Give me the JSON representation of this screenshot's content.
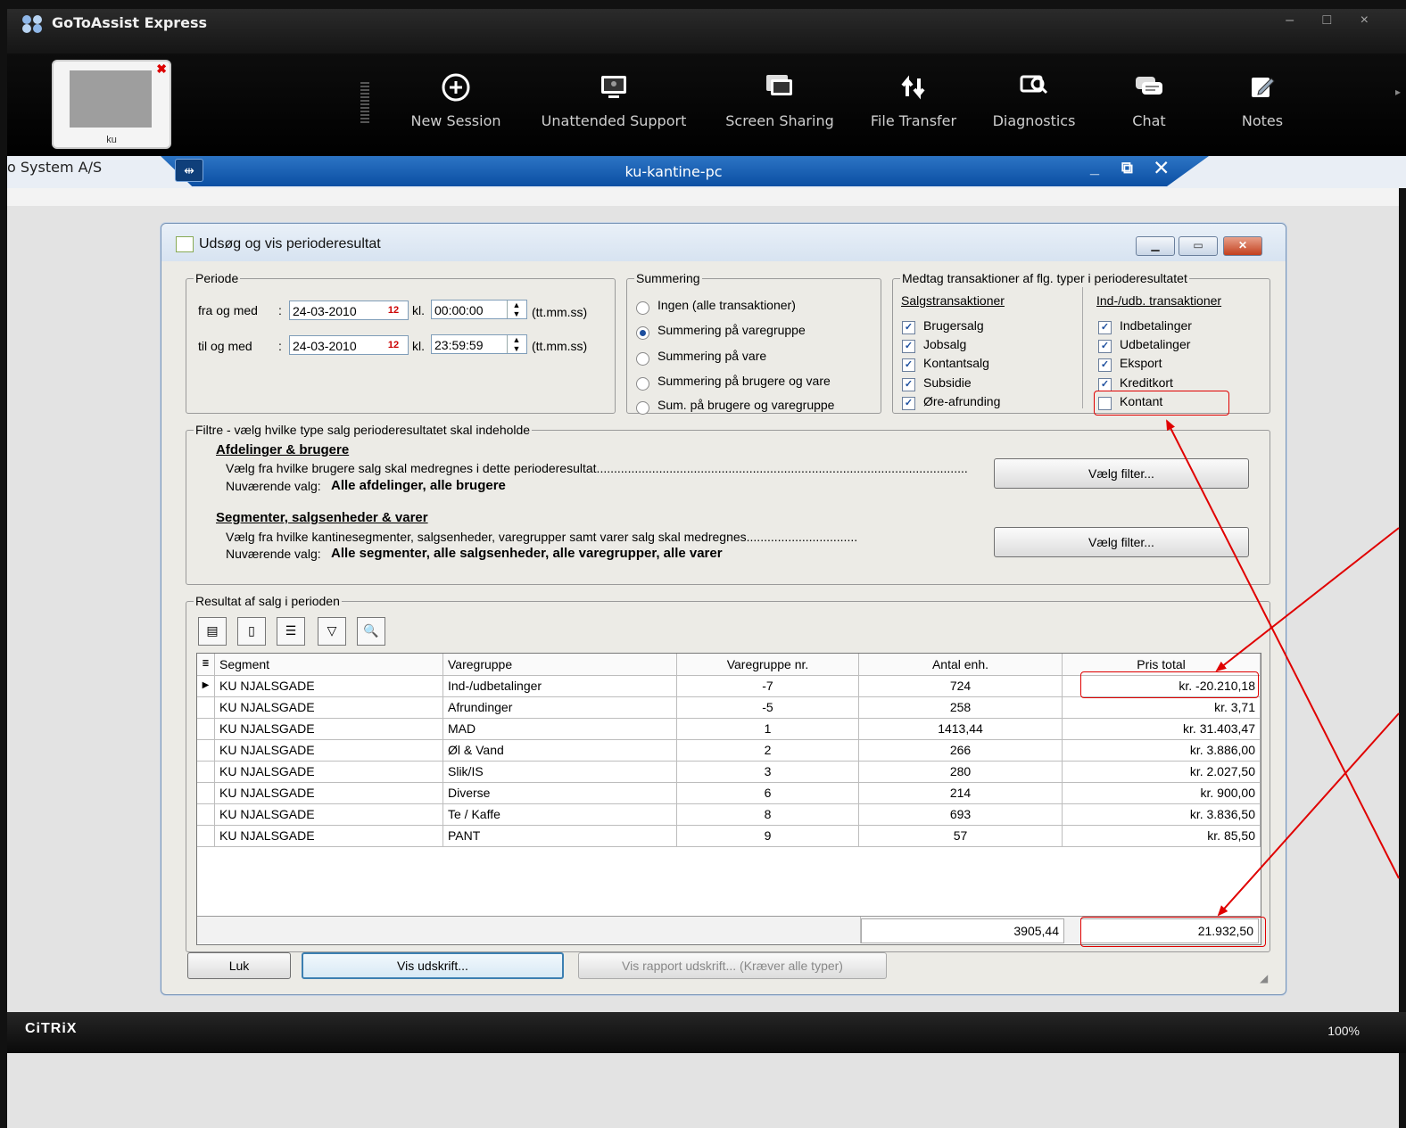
{
  "app": {
    "title": "GoToAssist Express",
    "window_controls": "– □ ×"
  },
  "thumbnail": {
    "label": "ku",
    "close": "✖"
  },
  "toolbar": {
    "new_session": "New Session",
    "unattended_support": "Unattended Support",
    "screen_sharing": "Screen Sharing",
    "file_transfer": "File Transfer",
    "diagnostics": "Diagnostics",
    "chat": "Chat",
    "notes": "Notes",
    "more": "▸"
  },
  "session": {
    "left_tab": "o System A/S",
    "title": "ku-kantine-pc",
    "controls": "_ ⧉ ✕"
  },
  "status": {
    "brand": "CiTRiX",
    "zoom": "100%"
  },
  "dialog": {
    "title": "Udsøg og vis perioderesultat",
    "periode": {
      "legend": "Periode",
      "from_label": "fra og med",
      "to_label": "til og med",
      "colon": ":",
      "from_date": "24-03-2010",
      "to_date": "24-03-2010",
      "kl": "kl.",
      "from_time": "00:00:00",
      "to_time": "23:59:59",
      "format": "(tt.mm.ss)",
      "cal": "12"
    },
    "summering": {
      "legend": "Summering",
      "options": [
        "Ingen (alle transaktioner)",
        "Summering på varegruppe",
        "Summering på vare",
        "Summering på brugere og vare",
        "Sum. på brugere og varegruppe"
      ],
      "selected": 1
    },
    "medtag": {
      "legend": "Medtag transaktioner af flg. typer i perioderesultatet",
      "salg_header": "Salgstransaktioner",
      "salg": [
        "Brugersalg",
        "Jobsalg",
        "Kontantsalg",
        "Subsidie",
        "Øre-afrunding"
      ],
      "indudb_header": "Ind-/udb. transaktioner",
      "indudb": [
        "Indbetalinger",
        "Udbetalinger",
        "Eksport",
        "Kreditkort",
        "Kontant"
      ],
      "indudb_checked": [
        true,
        true,
        true,
        true,
        false
      ],
      "check": "✓"
    },
    "filtre": {
      "legend": "Filtre - vælg hvilke type salg perioderesultatet skal indeholde",
      "afd_title": "Afdelinger & brugere",
      "afd_desc": "Vælg fra hvilke brugere salg skal medregnes i dette perioderesultat...........................................................................................................",
      "afd_current_label": "Nuværende valg:",
      "afd_current": "Alle afdelinger, alle brugere",
      "seg_title": "Segmenter, salgsenheder & varer",
      "seg_desc": "Vælg fra hvilke kantinesegmenter, salgsenheder, varegrupper samt varer salg skal medregnes................................",
      "seg_current_label": "Nuværende valg:",
      "seg_current": "Alle segmenter, alle salgsenheder, alle varegrupper, alle varer",
      "button": "Vælg filter..."
    },
    "resultat": {
      "legend": "Resultat af salg i perioden",
      "columns": [
        "Segment",
        "Varegruppe",
        "Varegruppe nr.",
        "Antal enh.",
        "Pris total"
      ],
      "rows": [
        [
          "KU NJALSGADE",
          "Ind-/udbetalinger",
          "-7",
          "724",
          "kr. -20.210,18"
        ],
        [
          "KU NJALSGADE",
          "Afrundinger",
          "-5",
          "258",
          "kr. 3,71"
        ],
        [
          "KU NJALSGADE",
          "MAD",
          "1",
          "1413,44",
          "kr. 31.403,47"
        ],
        [
          "KU NJALSGADE",
          "Øl & Vand",
          "2",
          "266",
          "kr. 3.886,00"
        ],
        [
          "KU NJALSGADE",
          "Slik/IS",
          "3",
          "280",
          "kr. 2.027,50"
        ],
        [
          "KU NJALSGADE",
          "Diverse",
          "6",
          "214",
          "kr. 900,00"
        ],
        [
          "KU NJALSGADE",
          "Te / Kaffe",
          "8",
          "693",
          "kr. 3.836,50"
        ],
        [
          "KU NJALSGADE",
          "PANT",
          "9",
          "57",
          "kr. 85,50"
        ]
      ],
      "total_units": "3905,44",
      "total_price": "21.932,50",
      "row_marker": "▶",
      "header_marker": "≣"
    },
    "buttons": {
      "luk": "Luk",
      "vis_udskrift": "Vis udskrift...",
      "vis_rapport": "Vis rapport udskrift... (Kræver alle typer)"
    }
  },
  "colors": {
    "annotation": "#e00000",
    "session_tab": "#0b4fa3",
    "checkbox": "#1d4f9e"
  }
}
